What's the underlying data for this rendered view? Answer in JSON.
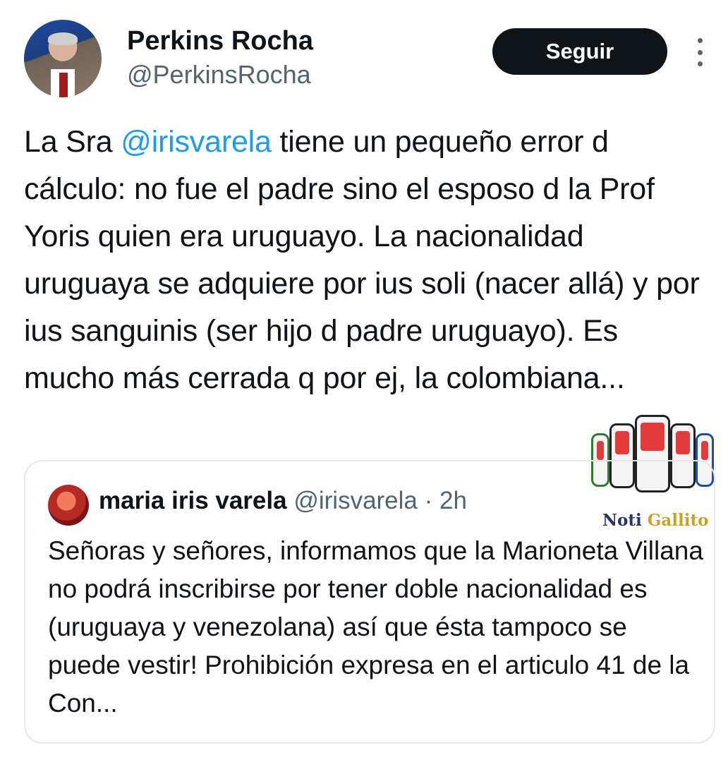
{
  "author": {
    "name": "Perkins Rocha",
    "handle": "@PerkinsRocha",
    "follow_label": "Seguir"
  },
  "tweet": {
    "prefix": "La Sra ",
    "mention": "@irisvarela",
    "body": " tiene un pequeño error d cálculo: no fue el padre sino el esposo d la Prof Yoris quien era uruguayo. La nacionalidad uruguaya se adquiere por ius soli (nacer allá) y por ius sanguinis (ser hijo d padre uruguayo). Es mucho más cerrada q por ej, la colombiana..."
  },
  "quoted_tweet": {
    "name": "maria iris varela",
    "handle": "@irisvarela",
    "separator": " · ",
    "time": "2h",
    "text": "Señoras y señores, informamos que la Marioneta Villana no podrá inscribirse por tener doble nacionalidad es (uruguaya y venezolana) así que ésta tampoco se puede vestir! Prohibición expresa en el articulo 41 de la Con..."
  },
  "watermark": {
    "part1": "Noti ",
    "part2": "Gallito"
  },
  "colors": {
    "mention": "#1d9bf0",
    "secondary_text": "#536471",
    "button": "#0f1419"
  },
  "icons": {
    "more": "more-vertical-icon"
  }
}
